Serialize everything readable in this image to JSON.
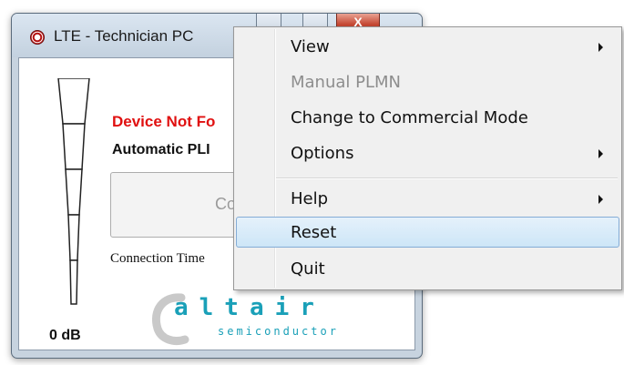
{
  "window": {
    "title": "LTE - Technician PC",
    "icon": "app-logo-icon",
    "buttons": {
      "close_label": "X"
    }
  },
  "main": {
    "signal": {
      "db_label": "0 dB",
      "level": 0,
      "bars": 5
    },
    "device_status": "Device Not Fo",
    "plmn_mode": "Automatic PLI",
    "connect_button_label": "Co",
    "connection_time_label": "Connection Time"
  },
  "logo": {
    "word": "altair",
    "sub": "semiconductor"
  },
  "context_menu": {
    "items": [
      {
        "label": "View",
        "submenu": true,
        "disabled": false,
        "hovered": false
      },
      {
        "label": "Manual PLMN",
        "submenu": false,
        "disabled": true,
        "hovered": false
      },
      {
        "label": "Change to Commercial Mode",
        "submenu": false,
        "disabled": false,
        "hovered": false
      },
      {
        "label": "Options",
        "submenu": true,
        "disabled": false,
        "hovered": false
      },
      {
        "label": "Help",
        "submenu": true,
        "disabled": false,
        "hovered": false
      },
      {
        "label": "Reset",
        "submenu": false,
        "disabled": false,
        "hovered": true
      },
      {
        "label": "Quit",
        "submenu": false,
        "disabled": false,
        "hovered": false
      }
    ]
  },
  "colors": {
    "error_text": "#e01010",
    "brand": "#1aa0b8",
    "hover_border": "#84acd6",
    "close_button": "#c64a35"
  }
}
